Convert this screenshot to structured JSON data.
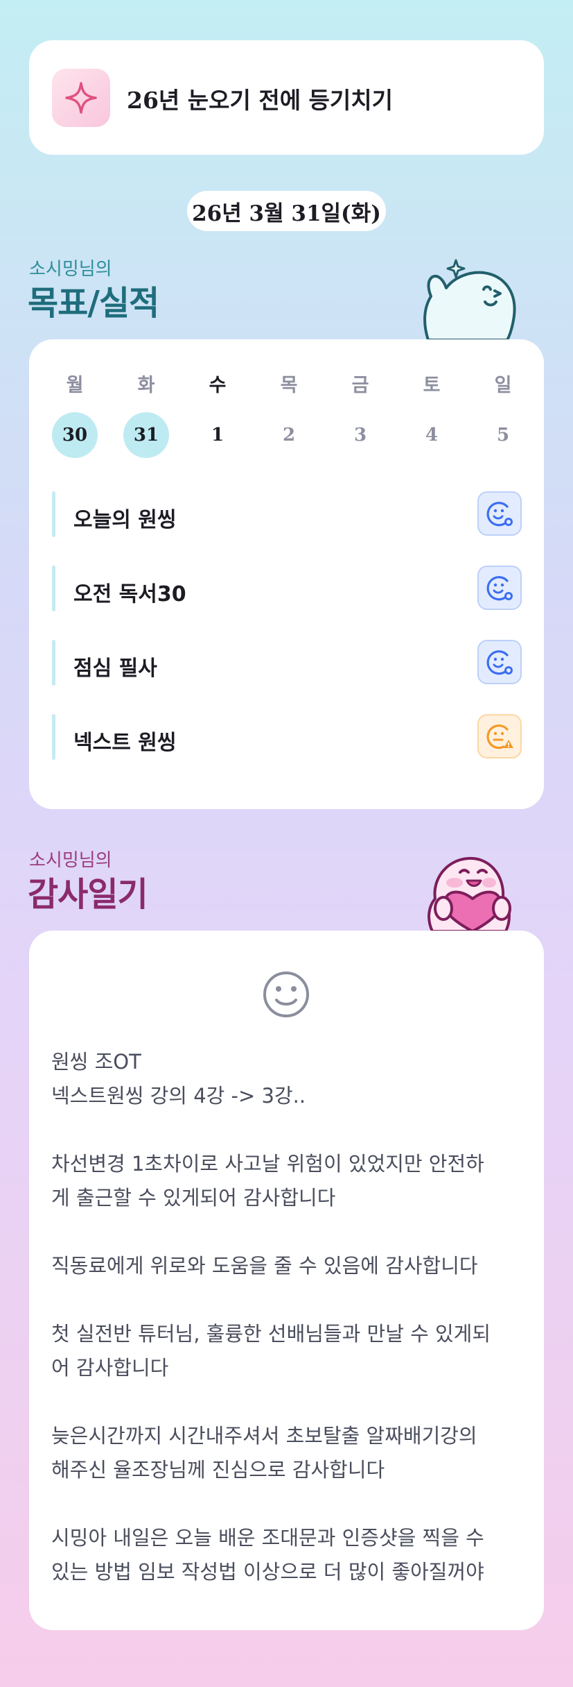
{
  "banner": {
    "title": "26년 눈오기 전에 등기치기",
    "icon": "sparkle-icon",
    "accent": "#e0517f"
  },
  "date_label": "26년 3월 31일(화)",
  "goal_section": {
    "subtitle": "소시밍님의",
    "title": "목표/실적"
  },
  "calendar": {
    "weekdays": [
      "월",
      "화",
      "수",
      "목",
      "금",
      "토",
      "일"
    ],
    "dates": [
      "30",
      "31",
      "1",
      "2",
      "3",
      "4",
      "5"
    ],
    "today_index": 2
  },
  "tasks": [
    {
      "label": "오늘의 원씽",
      "status": "done",
      "icon": "smile-check-icon",
      "color": "#3c6ef2"
    },
    {
      "label": "오전 독서30",
      "status": "done",
      "icon": "smile-check-icon",
      "color": "#3c6ef2"
    },
    {
      "label": "점심 필사",
      "status": "done",
      "icon": "smile-check-icon",
      "color": "#3c6ef2"
    },
    {
      "label": "넥스트 원씽",
      "status": "warning",
      "icon": "smile-warning-icon",
      "color": "#f39a28"
    }
  ],
  "gratitude_section": {
    "subtitle": "소시밍님의",
    "title": "감사일기"
  },
  "gratitude": {
    "mood_icon": "smile-icon",
    "paragraphs": [
      [
        "원씽 조OT",
        "넥스트원씽 강의 4강 -> 3강.."
      ],
      [
        "차선변경 1초차이로 사고날 위험이 있었지만 안전하",
        "게 출근할 수 있게되어 감사합니다"
      ],
      [
        "직동료에게 위로와 도움을 줄 수 있음에 감사합니다"
      ],
      [
        "첫 실전반 튜터님, 훌륭한 선배님들과 만날 수 있게되",
        "어 감사합니다"
      ],
      [
        "늦은시간까지 시간내주셔서 초보탈출 알짜배기강의",
        "해주신 율조장님께 진심으로 감사합니다"
      ],
      [
        "시밍아 내일은 오늘 배운 조대문과 인증샷을 찍을 수",
        "있는 방법 임보 작성법 이상으로 더 많이 좋아질꺼야"
      ]
    ]
  }
}
